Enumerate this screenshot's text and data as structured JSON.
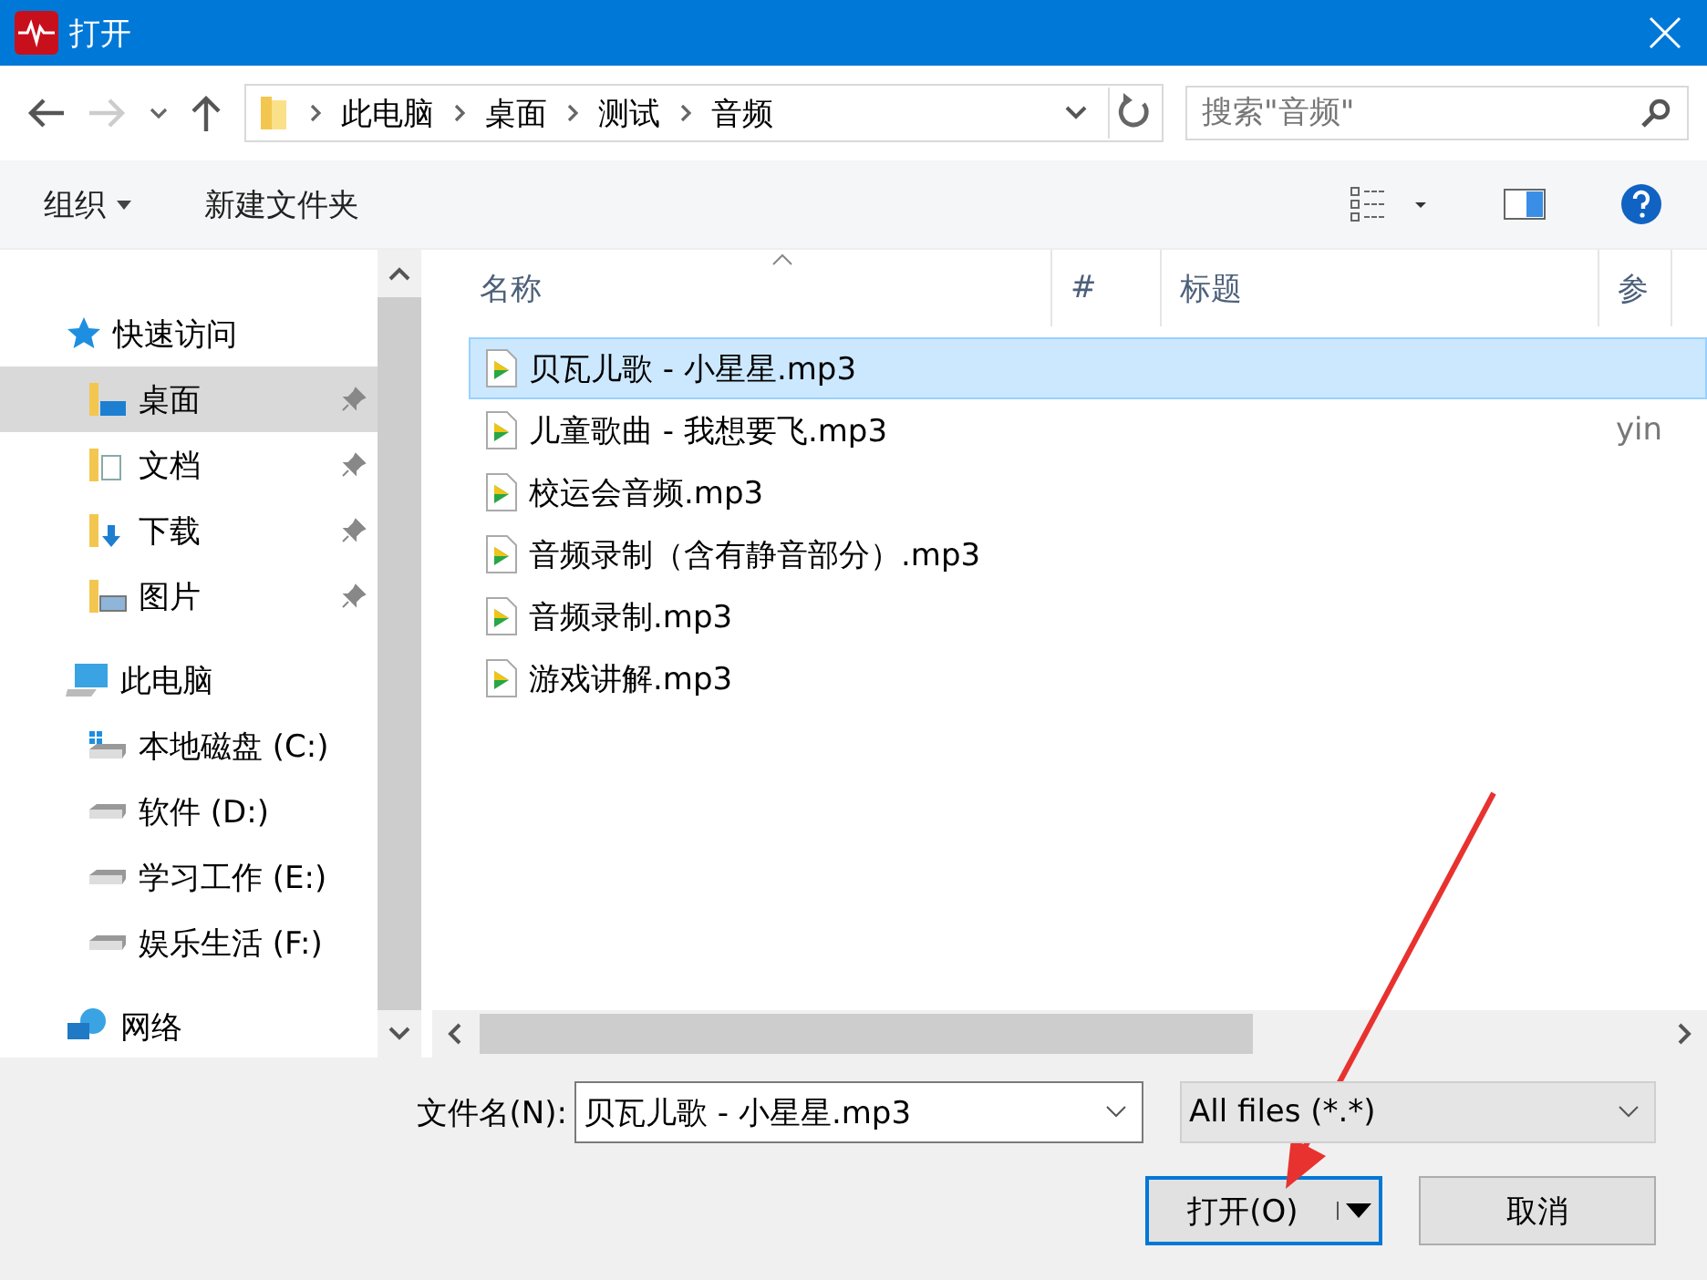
{
  "window": {
    "title": "打开"
  },
  "breadcrumb": [
    "此电脑",
    "桌面",
    "测试",
    "音频"
  ],
  "search": {
    "placeholder": "搜索\"音频\""
  },
  "toolbar": {
    "organize": "组织",
    "new_folder": "新建文件夹"
  },
  "sidebar": {
    "items": [
      {
        "label": "快速访问",
        "kind": "quick",
        "selected": false,
        "children": [
          {
            "label": "桌面",
            "kind": "desktop",
            "selected": true,
            "pinned": true
          },
          {
            "label": "文档",
            "kind": "docs",
            "selected": false,
            "pinned": true
          },
          {
            "label": "下载",
            "kind": "downloads",
            "selected": false,
            "pinned": true
          },
          {
            "label": "图片",
            "kind": "pictures",
            "selected": false,
            "pinned": true
          }
        ]
      },
      {
        "label": "此电脑",
        "kind": "pc",
        "selected": false,
        "children": [
          {
            "label": "本地磁盘 (C:)",
            "kind": "sysdrive",
            "selected": false,
            "pinned": false
          },
          {
            "label": "软件 (D:)",
            "kind": "drive",
            "selected": false,
            "pinned": false
          },
          {
            "label": "学习工作 (E:)",
            "kind": "drive",
            "selected": false,
            "pinned": false
          },
          {
            "label": "娱乐生活 (F:)",
            "kind": "drive",
            "selected": false,
            "pinned": false
          }
        ]
      },
      {
        "label": "网络",
        "kind": "network",
        "selected": false
      }
    ]
  },
  "table": {
    "columns": [
      "名称",
      "#",
      "标题",
      "参"
    ],
    "rows": [
      {
        "name": "贝瓦儿歌 - 小星星.mp3",
        "column_4": "",
        "selected": true
      },
      {
        "name": "儿童歌曲 - 我想要飞.mp3",
        "column_4": "yin",
        "selected": false
      },
      {
        "name": "校运会音频.mp3",
        "selected": false
      },
      {
        "name": "音频录制（含有静音部分）.mp3",
        "selected": false
      },
      {
        "name": "音频录制.mp3",
        "selected": false
      },
      {
        "name": "游戏讲解.mp3",
        "selected": false
      }
    ]
  },
  "footer": {
    "filename_label": "文件名(N):",
    "filename": "贝瓦儿歌 - 小星星.mp3",
    "filter": "All files (*.*)",
    "open": "打开(O)",
    "cancel": "取消"
  }
}
